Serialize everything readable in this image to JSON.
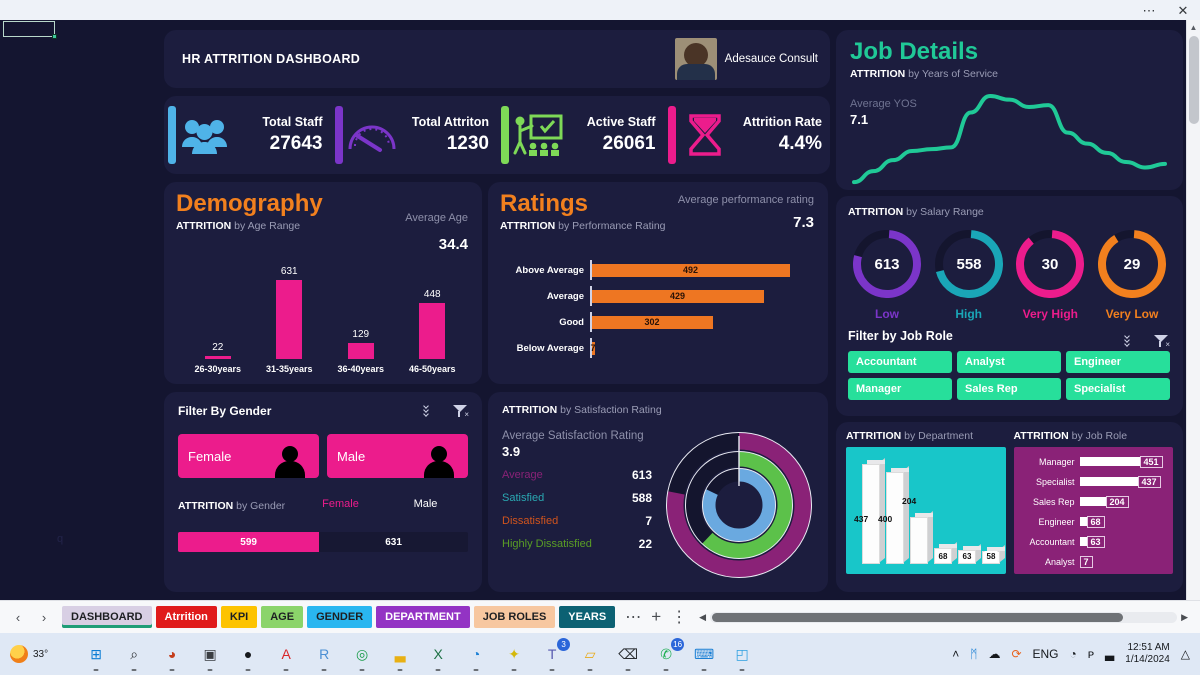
{
  "window": {
    "more_label": "⋯",
    "close_label": "✕"
  },
  "sheet": {
    "cell_reference": "",
    "watermark": "q"
  },
  "header": {
    "title": "HR ATTRITION DASHBOARD",
    "consultant": "Adesauce Consult"
  },
  "kpis": [
    {
      "label": "Total  Staff",
      "value": "27643",
      "accent": "#4fb3e8",
      "icon": "people-icon"
    },
    {
      "label": "Total  Attriton",
      "value": "1230",
      "accent": "#7b35c9",
      "icon": "gauge-icon"
    },
    {
      "label": "Active Staff",
      "value": "26061",
      "accent": "#7ed957",
      "icon": "trainer-icon"
    },
    {
      "label": "Attrition Rate",
      "value": "4.4%",
      "accent": "#ec1c8c",
      "icon": "hourglass-icon"
    }
  ],
  "demography": {
    "title": "Demography",
    "subtitle_bold": "ATTRITION",
    "subtitle_rest": " by Age Range",
    "average_label": "Average  Age",
    "average_value": "34.4",
    "chart_data": {
      "type": "bar",
      "title": "ATTRITION by Age Range",
      "categories": [
        "26-30years",
        "31-35years",
        "36-40years",
        "46-50years"
      ],
      "values": [
        22,
        631,
        129,
        448
      ],
      "xlabel": "",
      "ylabel": "",
      "ylim": [
        0,
        700
      ],
      "grid": false,
      "color": "#ec1c8c"
    }
  },
  "ratings": {
    "title": "Ratings",
    "subtitle_bold": "ATTRITION",
    "subtitle_rest": " by  Performance Rating",
    "average_label": "Average performance rating",
    "average_value": "7.3",
    "chart_data": {
      "type": "bar",
      "orientation": "horizontal",
      "title": "ATTRITION by Performance Rating",
      "categories": [
        "Above Average",
        "Average",
        "Good",
        "Below Average"
      ],
      "values": [
        492,
        429,
        302,
        7
      ],
      "xlabel": "",
      "ylabel": "",
      "xlim": [
        0,
        560
      ],
      "grid": false,
      "color": "#ee7622"
    }
  },
  "gender": {
    "title": "Filter By Gender",
    "list_icon": "multi-select-icon",
    "filter_icon": "clear-filter-icon",
    "buttons": [
      {
        "label": "Female",
        "icon": "female-avatar-icon"
      },
      {
        "label": "Male",
        "icon": "male-avatar-icon"
      }
    ],
    "attrition_bold": "ATTRITION",
    "attrition_rest": " by Gender",
    "chart_data": {
      "type": "bar",
      "orientation": "stacked-horizontal",
      "title": "ATTRITION by Gender",
      "categories": [
        "Female",
        "Male"
      ],
      "values": [
        599,
        631
      ],
      "colors": [
        "#ec1c8c",
        "#171833"
      ],
      "label_colors": [
        "#ec1c8c",
        "#ffffff"
      ]
    }
  },
  "satisfaction": {
    "title_bold": "ATTRITION",
    "title_rest": " by Satisfaction Rating",
    "average_label": "Average Satisfaction Rating",
    "average_value": "3.9",
    "chart_data": {
      "type": "pie",
      "title": "ATTRITION by Satisfaction Rating",
      "categories": [
        "Average",
        "Satisfied",
        "Dissatisfied",
        "Highly Dissatisfied"
      ],
      "values": [
        613,
        588,
        7,
        22
      ],
      "colors": [
        "#8a2277",
        "#2aa9b3",
        "#d1541d",
        "#5a9e25"
      ],
      "legend": "left"
    }
  },
  "job_details": {
    "title": "Job Details",
    "subtitle_bold": "ATTRITION",
    "subtitle_rest": " by Years of Service",
    "avg_label": "Average YOS",
    "avg_value": "7.1",
    "chart_data": {
      "type": "area",
      "title": "ATTRITION by Years of Service",
      "x": [
        0,
        1,
        2,
        3,
        4,
        5,
        6,
        7,
        8,
        9,
        10,
        11,
        12,
        13,
        14,
        15,
        16
      ],
      "values": [
        2,
        14,
        26,
        36,
        38,
        40,
        78,
        96,
        92,
        84,
        86,
        56,
        44,
        34,
        24,
        18,
        22
      ],
      "color": "#20c997",
      "grid": false
    }
  },
  "salary": {
    "title_bold": "ATTRITION",
    "title_rest": " by Salary Range",
    "chart_data": {
      "type": "pie",
      "title": "ATTRITION by Salary Range",
      "categories": [
        "Low",
        "High",
        "Very High",
        "Very Low"
      ],
      "values": [
        613,
        558,
        30,
        29
      ],
      "colors": [
        "#7b35c9",
        "#1aa6b7",
        "#ec1c8c",
        "#f2801e"
      ],
      "percent_of_ring": [
        78,
        70,
        88,
        90
      ]
    },
    "filter_title": "Filter by Job Role",
    "list_icon": "multi-select-icon",
    "filter_icon": "clear-filter-icon",
    "roles": [
      "Accountant",
      "Analyst",
      "Engineer",
      "Manager",
      "Sales Rep",
      "Specialist"
    ]
  },
  "department": {
    "title_bold": "ATTRITION",
    "title_rest": " by Department",
    "chart_data": {
      "type": "bar",
      "title": "ATTRITION by Department",
      "categories": [
        "",
        "",
        "",
        "",
        "",
        ""
      ],
      "values": [
        437,
        400,
        204,
        68,
        63,
        58
      ],
      "bar_color": "#fdfdfd",
      "panel_color": "#18c6c9"
    }
  },
  "job_role": {
    "title_bold": "ATTRITION",
    "title_rest": " by Job Role",
    "chart_data": {
      "type": "bar",
      "orientation": "horizontal",
      "title": "ATTRITION by Job Role",
      "categories": [
        "Manager",
        "Specialist",
        "Sales Rep",
        "Engineer",
        "Accountant",
        "Analyst"
      ],
      "values": [
        451,
        437,
        204,
        68,
        63,
        7
      ],
      "bar_color": "#ffffff",
      "panel_color": "#8a2277"
    }
  },
  "sheet_tabs": {
    "prev_label": "‹",
    "next_label": "›",
    "more_label": "⋯",
    "add_label": "+",
    "menu_label": "⋮",
    "tabs": [
      {
        "label": "DASHBOARD",
        "bg": "#d8cfe4",
        "fg": "#1d1f22",
        "active": true
      },
      {
        "label": "Atrrition",
        "bg": "#e01b1b",
        "fg": "#ffffff",
        "active": false
      },
      {
        "label": "KPI",
        "bg": "#fdc300",
        "fg": "#1d1f22",
        "active": false
      },
      {
        "label": "AGE",
        "bg": "#8bd46a",
        "fg": "#1d1f22",
        "active": false
      },
      {
        "label": "GENDER",
        "bg": "#29b6f0",
        "fg": "#1d1f22",
        "active": false
      },
      {
        "label": "DEPARTMENT",
        "bg": "#9333c4",
        "fg": "#ffffff",
        "active": false
      },
      {
        "label": "JOB ROLES",
        "bg": "#f7c7a0",
        "fg": "#1d1f22",
        "active": false
      },
      {
        "label": "YEARS",
        "bg": "#0c6173",
        "fg": "#ffffff",
        "active": false
      }
    ]
  },
  "taskbar": {
    "weather_temp": "33°",
    "icons": [
      {
        "name": "start-icon",
        "glyph": "⊞",
        "color": "#0a7cd4",
        "badge": ""
      },
      {
        "name": "search-icon",
        "glyph": "⌕",
        "color": "#2a2d31",
        "badge": ""
      },
      {
        "name": "powerpoint-icon",
        "glyph": "◕",
        "color": "#c43e1c",
        "badge": ""
      },
      {
        "name": "files-icon",
        "glyph": "▣",
        "color": "#3a3d42",
        "badge": ""
      },
      {
        "name": "tableau-icon",
        "glyph": "●",
        "color": "#15181c",
        "badge": ""
      },
      {
        "name": "acrobat-icon",
        "glyph": "A",
        "color": "#d8262b",
        "badge": ""
      },
      {
        "name": "rstudio-icon",
        "glyph": "R",
        "color": "#4b8fd4",
        "badge": ""
      },
      {
        "name": "chrome-icon",
        "glyph": "◎",
        "color": "#1a9c4a",
        "badge": ""
      },
      {
        "name": "powerbi-icon",
        "glyph": "▃",
        "color": "#e8b013",
        "badge": ""
      },
      {
        "name": "excel-icon",
        "glyph": "X",
        "color": "#1d7145",
        "badge": ""
      },
      {
        "name": "edge-icon",
        "glyph": "◔",
        "color": "#1a7fd4",
        "badge": ""
      },
      {
        "name": "photoshop-icon",
        "glyph": "✦",
        "color": "#d4b80a",
        "badge": ""
      },
      {
        "name": "teams-icon",
        "glyph": "T",
        "color": "#5558af",
        "badge": "3"
      },
      {
        "name": "file-explorer-icon",
        "glyph": "▱",
        "color": "#e8ab1c",
        "badge": ""
      },
      {
        "name": "terminal-icon",
        "glyph": "⌫",
        "color": "#2a2d31",
        "badge": ""
      },
      {
        "name": "whatsapp-icon",
        "glyph": "✆",
        "color": "#1faf54",
        "badge": "16"
      },
      {
        "name": "vscode-icon",
        "glyph": "⌨",
        "color": "#1a7fd4",
        "badge": ""
      },
      {
        "name": "photos-icon",
        "glyph": "◰",
        "color": "#2fa0e0",
        "badge": ""
      }
    ],
    "tray": [
      {
        "name": "show-hidden-icons",
        "glyph": "˄"
      },
      {
        "name": "bluetooth-icon",
        "glyph": "ᛗ"
      },
      {
        "name": "onedrive-icon",
        "glyph": "☁"
      },
      {
        "name": "update-icon",
        "glyph": "⟳"
      }
    ],
    "language": "ENG",
    "wifi_icon": "◔",
    "volume_icon": "ᴘ",
    "battery_icon": "▃",
    "time": "12:51 AM",
    "date": "1/14/2024",
    "notification_icon": "△"
  }
}
